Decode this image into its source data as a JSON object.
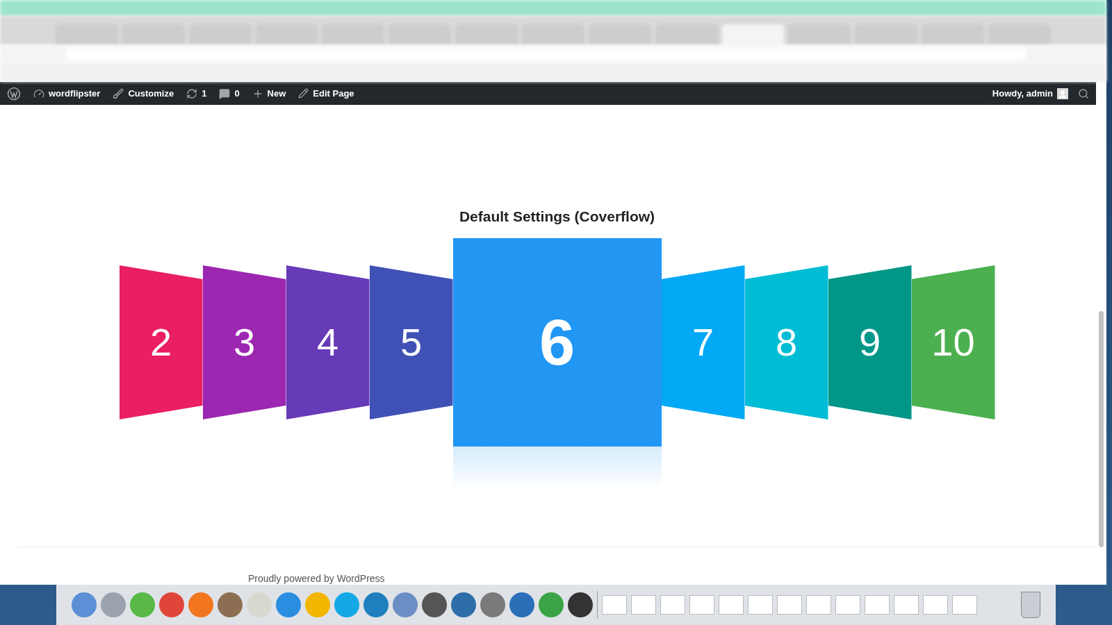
{
  "admin_bar": {
    "site": "wordflipster",
    "customize": "Customize",
    "updates": "1",
    "comments": "0",
    "new": "New",
    "edit": "Edit Page",
    "greeting": "Howdy, admin"
  },
  "page": {
    "title": "Default Settings (Coverflow)"
  },
  "coverflow": [
    {
      "label": "2",
      "kind": "left",
      "color": "#e91e63"
    },
    {
      "label": "3",
      "kind": "left",
      "color": "#9c27b0"
    },
    {
      "label": "4",
      "kind": "left",
      "color": "#673ab7"
    },
    {
      "label": "5",
      "kind": "left",
      "color": "#3f51b5"
    },
    {
      "label": "6",
      "kind": "center",
      "color": "#2196f3"
    },
    {
      "label": "7",
      "kind": "right",
      "color": "#03a9f4"
    },
    {
      "label": "8",
      "kind": "right",
      "color": "#00bcd4"
    },
    {
      "label": "9",
      "kind": "right",
      "color": "#009688"
    },
    {
      "label": "10",
      "kind": "right",
      "color": "#4caf50"
    }
  ],
  "footer": {
    "text": "Proudly powered by WordPress"
  }
}
